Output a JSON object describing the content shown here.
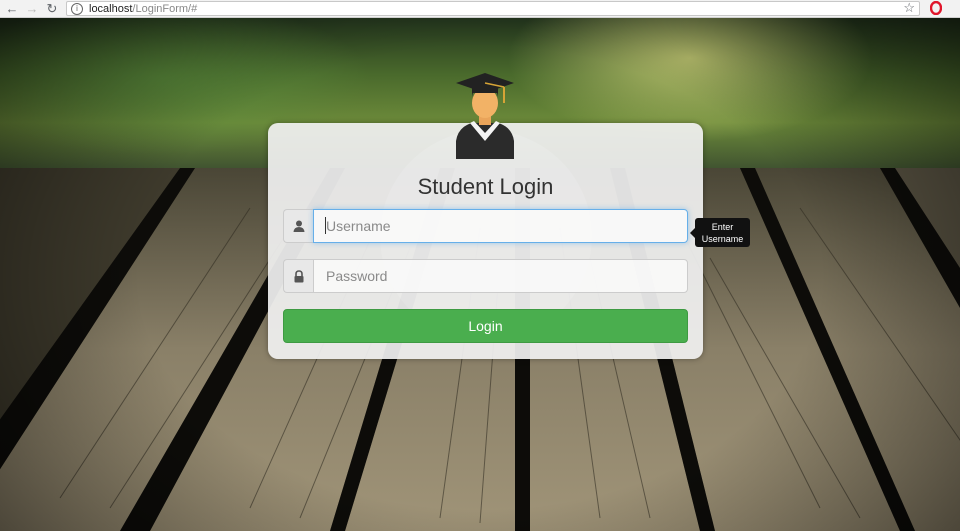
{
  "browser": {
    "url_host": "localhost",
    "url_path": "/LoginForm/#",
    "back_icon": "arrow-left-icon",
    "forward_icon": "arrow-right-icon",
    "reload_icon": "reload-icon",
    "bookmark_icon": "star-icon",
    "extension_icon": "opera-icon"
  },
  "login": {
    "title": "Student Login",
    "username": {
      "placeholder": "Username",
      "value": "",
      "icon": "user-icon"
    },
    "password": {
      "placeholder": "Password",
      "value": "",
      "icon": "lock-icon"
    },
    "submit_label": "Login",
    "tooltip": {
      "line1": "Enter",
      "line2": "Username"
    }
  },
  "colors": {
    "accent": "#4aae4e",
    "focus": "#66afe9"
  }
}
